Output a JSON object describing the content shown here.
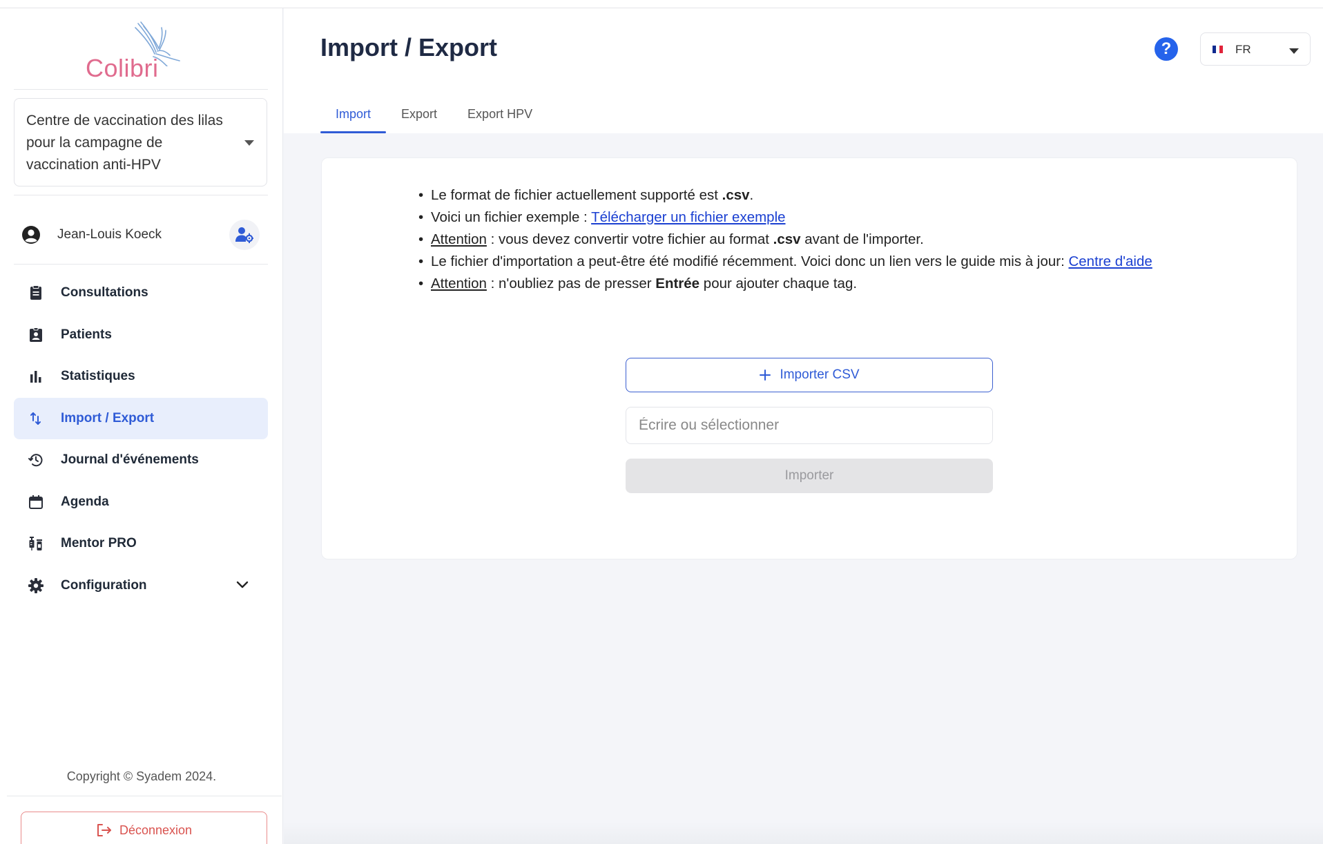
{
  "app": {
    "logo_text": "Colibri",
    "colors": {
      "primary": "#2f5bd6",
      "logo": "#e06b8e",
      "danger": "#d9534f",
      "active_bg": "#e8eefc"
    }
  },
  "sidebar": {
    "center_select": {
      "value": "Centre de vaccination des lilas pour la campagne de vaccination anti-HPV"
    },
    "user": {
      "name": "Jean-Louis Koeck",
      "avatar_icon": "user-circle-icon",
      "settings_icon": "user-gear-icon"
    },
    "nav": [
      {
        "label": "Consultations",
        "icon": "clipboard-icon"
      },
      {
        "label": "Patients",
        "icon": "id-badge-icon"
      },
      {
        "label": "Statistiques",
        "icon": "bar-chart-icon"
      },
      {
        "label": "Import / Export",
        "icon": "swap-vertical-icon",
        "active": true
      },
      {
        "label": "Journal d'événements",
        "icon": "history-icon"
      },
      {
        "label": "Agenda",
        "icon": "calendar-icon"
      },
      {
        "label": "Mentor PRO",
        "icon": "syringe-vial-icon"
      },
      {
        "label": "Configuration",
        "icon": "gear-icon",
        "expandable": true
      }
    ],
    "copyright": "Copyright © Syadem 2024.",
    "logout_label": "Déconnexion"
  },
  "header": {
    "title": "Import / Export",
    "help_label": "?",
    "language": {
      "code": "FR",
      "flag": [
        "#0f2a8f",
        "#ffffff",
        "#e1243b"
      ]
    },
    "tabs": [
      {
        "label": "Import",
        "active": true
      },
      {
        "label": "Export"
      },
      {
        "label": "Export HPV"
      }
    ]
  },
  "main": {
    "notes": {
      "line1_pre": "Le format de fichier actuellement supporté est ",
      "line1_bold": ".csv",
      "line1_post": ".",
      "line2_pre": "Voici un fichier exemple : ",
      "line2_link": "Télécharger un fichier exemple",
      "line3_underline": "Attention",
      "line3_pre": " : vous devez convertir votre fichier au format ",
      "line3_bold": ".csv",
      "line3_post": " avant de l'importer.",
      "line4_pre": "Le fichier d'importation a peut-être été modifié récemment. Voici donc un lien vers le guide mis à jour: ",
      "line4_link": "Centre d'aide",
      "line5_underline": "Attention",
      "line5_pre": " : n'oubliez pas de presser ",
      "line5_bold": "Entrée",
      "line5_post": " pour ajouter chaque tag."
    },
    "import_csv_label": "Importer CSV",
    "tag_input": {
      "value": "",
      "placeholder": "Écrire ou sélectionner"
    },
    "import_button_label": "Importer"
  }
}
